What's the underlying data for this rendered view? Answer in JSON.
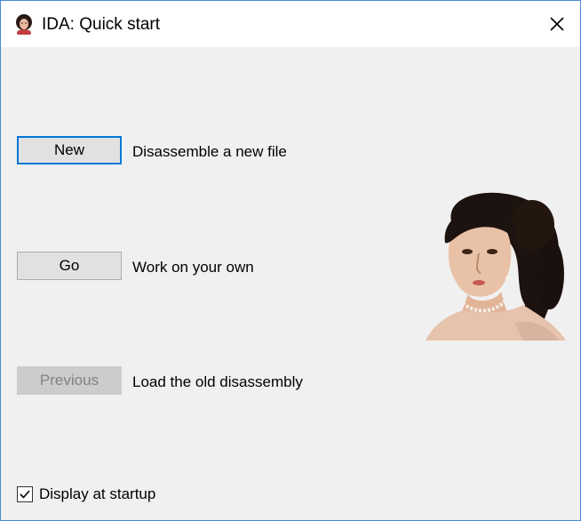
{
  "window": {
    "title": "IDA: Quick start",
    "icon": "ida-portrait-icon",
    "close_icon": "close-icon"
  },
  "actions": [
    {
      "button_label": "New",
      "description": "Disassemble a new file",
      "state": "default"
    },
    {
      "button_label": "Go",
      "description": "Work on your own",
      "state": "normal"
    },
    {
      "button_label": "Previous",
      "description": "Load the old disassembly",
      "state": "disabled"
    }
  ],
  "startup": {
    "label": "Display at startup",
    "checked": true
  },
  "colors": {
    "accent": "#0078d7",
    "window_border": "#4a8ad4",
    "dialog_bg": "#f0f0f0",
    "button_bg": "#e1e1e1",
    "disabled_text": "#838383"
  }
}
